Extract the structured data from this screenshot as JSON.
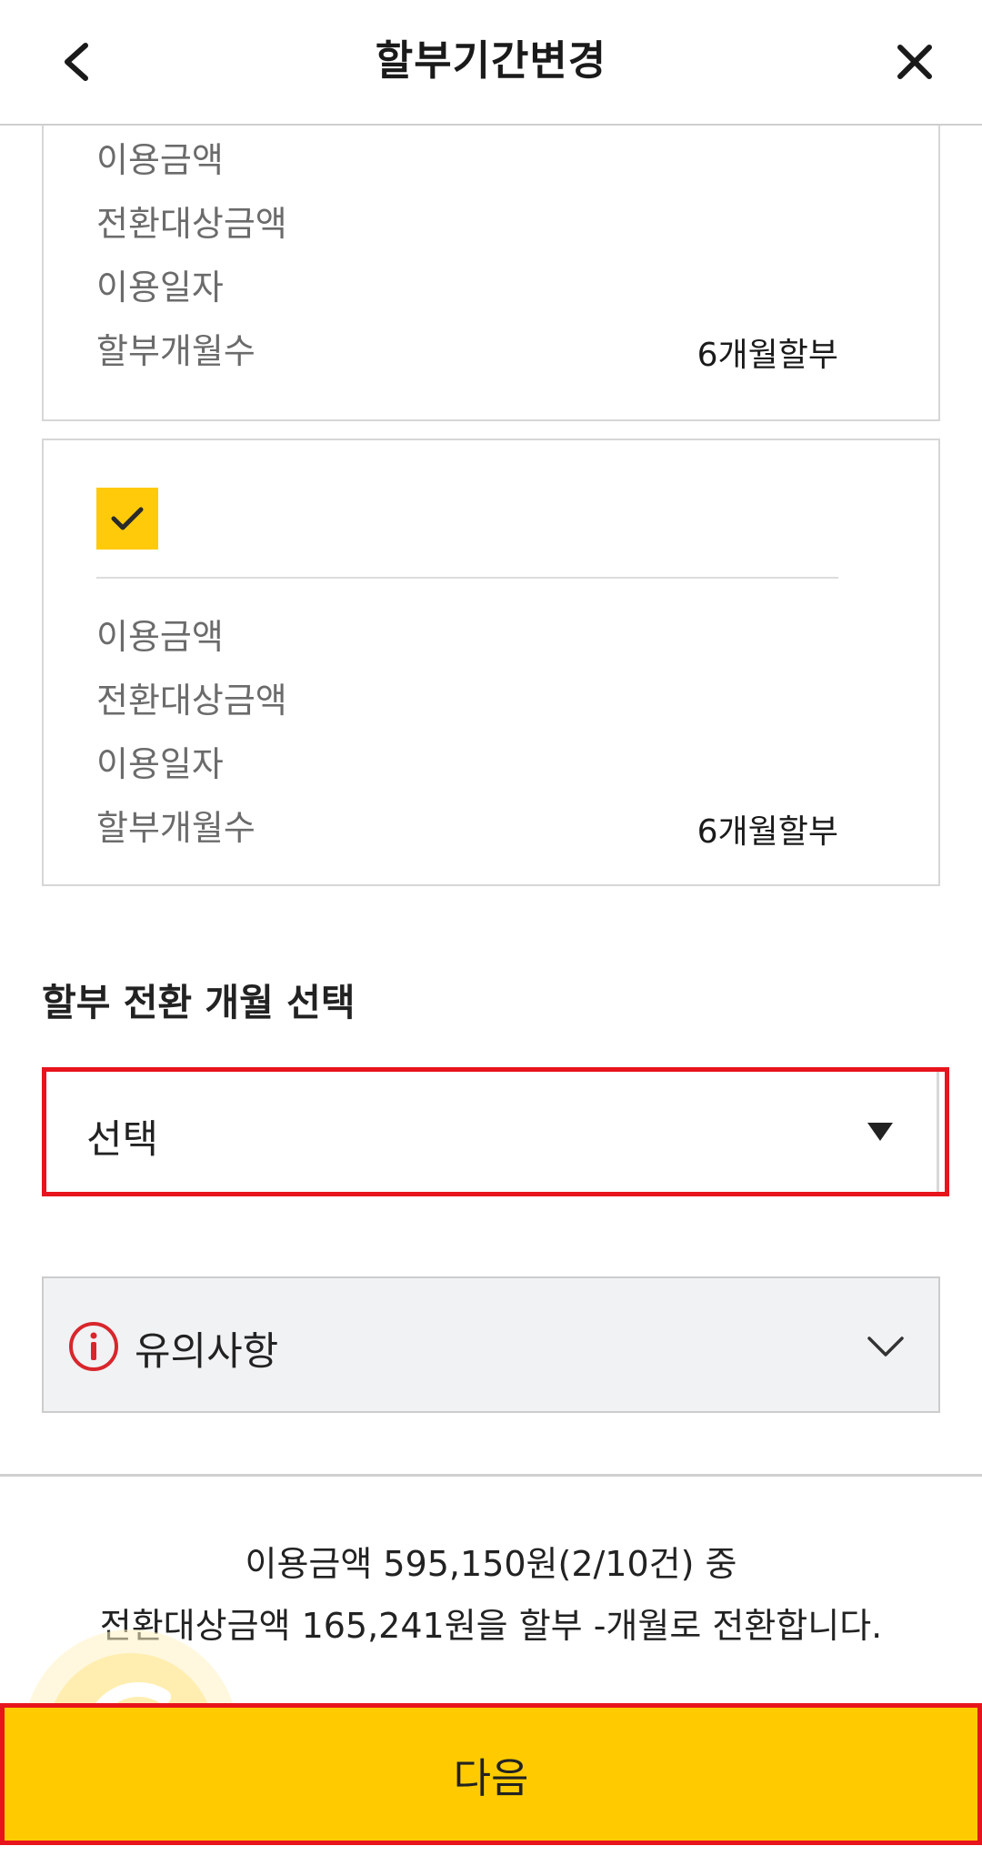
{
  "header": {
    "title": "할부기간변경",
    "back_icon": "chevron-left-icon",
    "close_icon": "close-icon"
  },
  "cards": [
    {
      "checked": null,
      "rows": [
        {
          "label": "이용금액",
          "value": ""
        },
        {
          "label": "전환대상금액",
          "value": ""
        },
        {
          "label": "이용일자",
          "value": ""
        },
        {
          "label": "할부개월수",
          "value": "6개월할부"
        }
      ]
    },
    {
      "checked": true,
      "rows": [
        {
          "label": "이용금액",
          "value": ""
        },
        {
          "label": "전환대상금액",
          "value": ""
        },
        {
          "label": "이용일자",
          "value": ""
        },
        {
          "label": "할부개월수",
          "value": "6개월할부"
        }
      ]
    }
  ],
  "installment": {
    "section_title": "할부 전환 개월 선택",
    "selected_value": "선택"
  },
  "notice": {
    "label": "유의사항",
    "icon": "info-icon"
  },
  "summary": {
    "line1": "이용금액 595,150원(2/10건) 중",
    "line2": "전환대상금액 165,241원을 할부 -개월로 전환합니다."
  },
  "footer": {
    "next_label": "다음"
  },
  "colors": {
    "accent_yellow": "#ffcb00",
    "highlight_red": "#e8141c",
    "info_red": "#d8262c"
  }
}
